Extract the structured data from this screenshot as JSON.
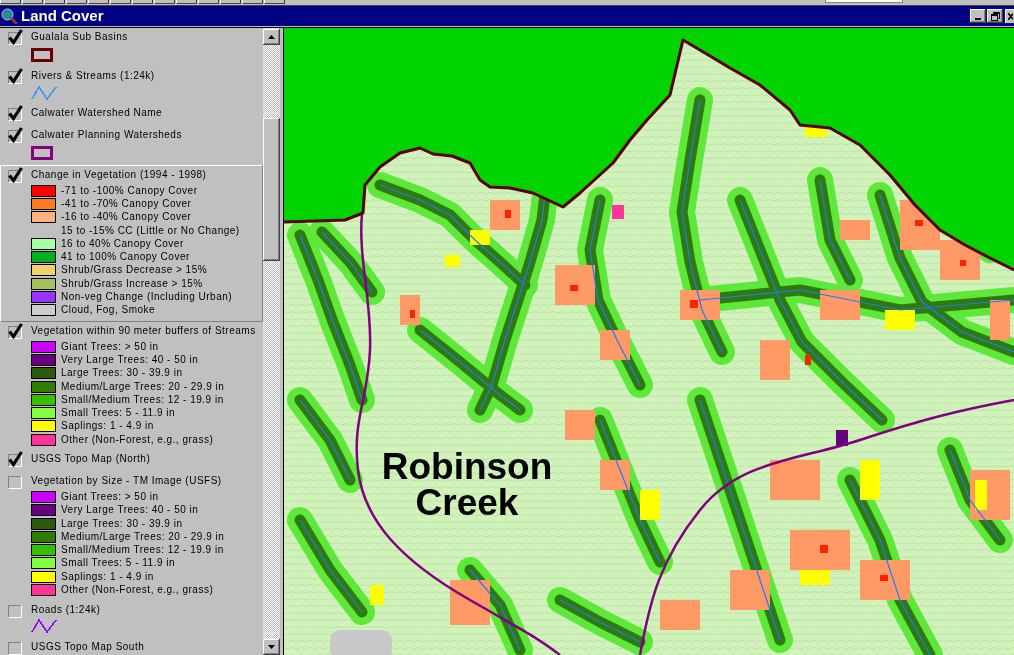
{
  "window": {
    "title": "Land Cover"
  },
  "legend": {
    "layers": [
      {
        "name": "Gualala Sub Basins",
        "checked": true,
        "selected": false,
        "symbol": {
          "kind": "outline",
          "color": "#6b0000"
        }
      },
      {
        "name": "Rivers & Streams (1:24k)",
        "checked": true,
        "selected": false,
        "symbol": {
          "kind": "line",
          "color": "#3399ff"
        }
      },
      {
        "name": "Calwater Watershed Name",
        "checked": true,
        "selected": false
      },
      {
        "name": "Calwater Planning Watersheds",
        "checked": true,
        "selected": false,
        "symbol": {
          "kind": "outline",
          "color": "#800080"
        }
      },
      {
        "name": "Change in Vegetation (1994 - 1998)",
        "checked": true,
        "selected": true,
        "classes": [
          {
            "label": "-71 to -100% Canopy Cover",
            "color": "#ff0000"
          },
          {
            "label": "-41 to -70% Canopy Cover",
            "color": "#ff7a22"
          },
          {
            "label": "-16 to -40% Canopy Cover",
            "color": "#ffb380"
          },
          {
            "label": "15 to -15% CC (Little or No Change)"
          },
          {
            "label": "16 to 40% Canopy Cover",
            "color": "#a8ffa8"
          },
          {
            "label": "41 to 100% Canopy Cover",
            "color": "#00b020"
          },
          {
            "label": "Shrub/Grass Decrease > 15%",
            "color": "#f0d070"
          },
          {
            "label": "Shrub/Grass Increase > 15%",
            "color": "#a8c060"
          },
          {
            "label": "Non-veg Change (Including Urban)",
            "color": "#9933ff"
          },
          {
            "label": "Cloud, Fog, Smoke",
            "color": "#cccccc"
          }
        ]
      },
      {
        "name": "Vegetation within 90 meter buffers of Streams",
        "checked": true,
        "selected": false,
        "classes": [
          {
            "label": "Giant Trees: > 50 in",
            "color": "#cc00ff"
          },
          {
            "label": "Very Large Trees: 40 - 50 in",
            "color": "#660080"
          },
          {
            "label": "Large Trees: 30 - 39.9 in",
            "color": "#2a5a0a"
          },
          {
            "label": "Medium/Large Trees: 20 - 29.9 in",
            "color": "#2d7d00"
          },
          {
            "label": "Small/Medium Trees: 12 - 19.9 in",
            "color": "#33c000"
          },
          {
            "label": "Small Trees: 5 - 11.9 in",
            "color": "#80ff40"
          },
          {
            "label": "Saplings: 1 - 4.9 in",
            "color": "#ffff00"
          },
          {
            "label": "Other (Non-Forest, e.g., grass)",
            "color": "#ff3399"
          }
        ]
      },
      {
        "name": "USGS Topo Map (North)",
        "checked": true,
        "selected": false
      },
      {
        "name": "Vegetation by Size - TM Image (USFS)",
        "checked": false,
        "selected": false,
        "classes": [
          {
            "label": "Giant Trees: > 50 in",
            "color": "#cc00ff"
          },
          {
            "label": "Very Large Trees: 40 - 50 in",
            "color": "#660080"
          },
          {
            "label": "Large Trees: 30 - 39.9 in",
            "color": "#2a5a0a"
          },
          {
            "label": "Medium/Large Trees: 20 - 29.9 in",
            "color": "#2d7d00"
          },
          {
            "label": "Small/Medium Trees: 12 - 19.9 in",
            "color": "#33c000"
          },
          {
            "label": "Small Trees: 5 - 11.9 in",
            "color": "#80ff40"
          },
          {
            "label": "Saplings: 1 - 4.9 in",
            "color": "#ffff00"
          },
          {
            "label": "Other (Non-Forest, e.g., grass)",
            "color": "#ff3399"
          }
        ]
      },
      {
        "name": "Roads (1:24k)",
        "checked": false,
        "selected": false,
        "symbol": {
          "kind": "line",
          "color": "#9900ff"
        }
      },
      {
        "name": "USGS Topo Map South",
        "checked": false,
        "selected": false
      }
    ]
  },
  "map": {
    "labels": [
      {
        "text": "Robinson Creek"
      }
    ]
  }
}
